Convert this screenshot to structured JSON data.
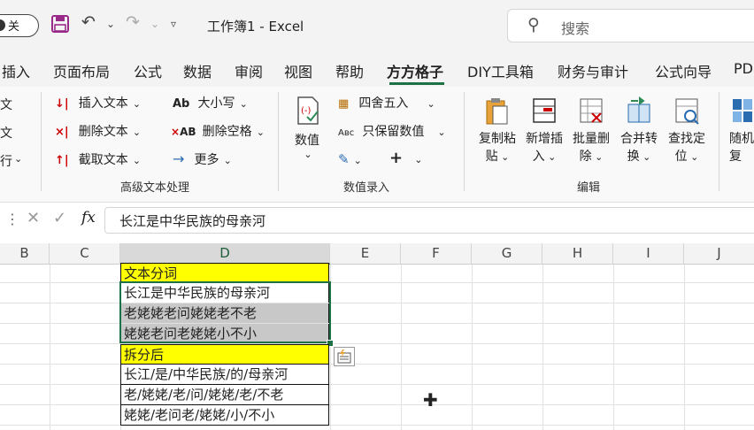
{
  "titlebar": {
    "autosave_toggle_label": "关",
    "workbook_title": "工作簿1  -  Excel",
    "search_placeholder": "搜索"
  },
  "tabs": [
    "插入",
    "页面布局",
    "公式",
    "数据",
    "审阅",
    "视图",
    "帮助",
    "方方格子",
    "DIY工具箱",
    "财务与审计",
    "公式向导",
    "PD"
  ],
  "active_tab": "方方格子",
  "ribbon": {
    "left_partial": [
      "文",
      "文",
      "行"
    ],
    "advanced_text": {
      "insert_text": "插入文本",
      "delete_text": "删除文本",
      "extract_text": "截取文本",
      "case": "大小写",
      "delete_space": "删除空格",
      "more": "更多",
      "group_label": "高级文本处理"
    },
    "numeric": {
      "value_btn": "数值",
      "round": "四舍五入",
      "keep_value": "只保留数值",
      "group_label": "数值录入"
    },
    "edit": {
      "copy_paste": [
        "复制粘",
        "贴"
      ],
      "new_insert": [
        "新增插",
        "入"
      ],
      "batch_delete": [
        "批量删",
        "除"
      ],
      "merge_convert": [
        "合并转",
        "换"
      ],
      "find_locate": [
        "查找定",
        "位"
      ],
      "random_repeat": [
        "随机",
        "复"
      ],
      "group_label": "编辑"
    }
  },
  "formula_bar": {
    "fx": "fx",
    "content": "长江是中华民族的母亲河"
  },
  "columns": [
    "B",
    "C",
    "D",
    "E",
    "F",
    "G",
    "H",
    "I",
    "J"
  ],
  "selected_column": "D",
  "cells": {
    "header1": "文本分词",
    "r1": "长江是中华民族的母亲河",
    "r2": "老姥姥老问姥姥老不老",
    "r3": "姥姥老问老姥姥小不小",
    "header2": "拆分后",
    "s1": "长江/是/中华民族/的/母亲河",
    "s2": "老/姥姥/老/问/姥姥/老/不老",
    "s3": "姥姥/老问老/姥姥/小/不小"
  },
  "colors": {
    "accent_green": "#1e7145",
    "header_yellow": "#ffff00",
    "selection_gray": "#c8c8c8"
  }
}
